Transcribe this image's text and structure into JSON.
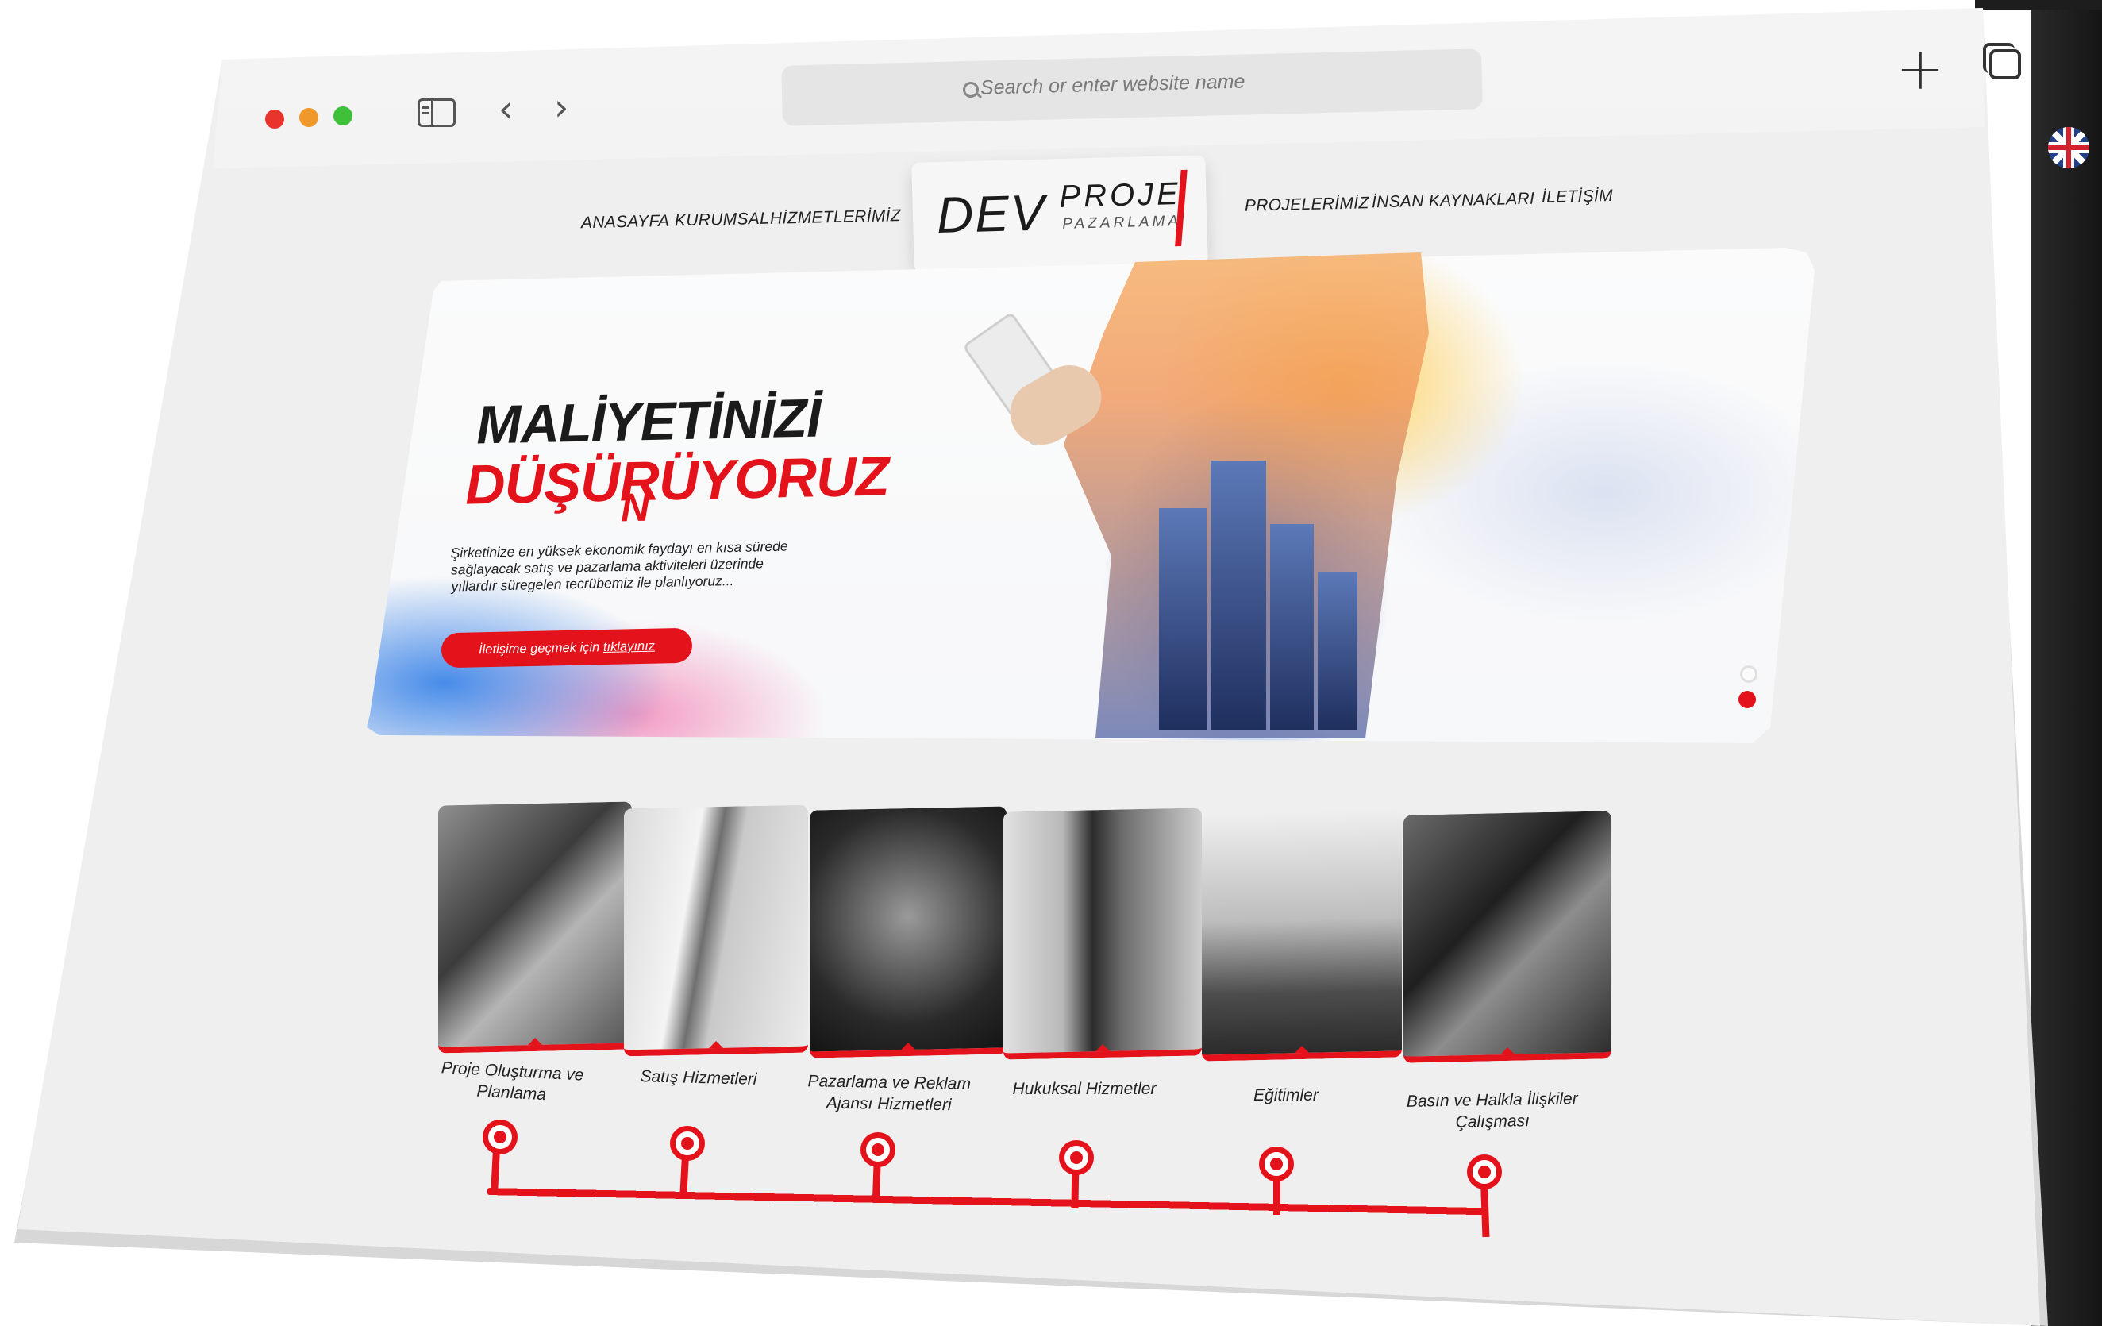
{
  "browser": {
    "address_placeholder": "Search or enter website name",
    "icons": [
      "sidebar-icon",
      "back-arrow-icon",
      "forward-arrow-icon",
      "search-icon",
      "new-tab-plus-icon",
      "tabs-overview-icon",
      "uk-flag-icon"
    ]
  },
  "site": {
    "nav_left": [
      "ANASAYFA",
      "KURUMSAL",
      "HİZMETLERİMİZ"
    ],
    "nav_right": [
      "PROJELERİMİZ",
      "İNSAN KAYNAKLARI",
      "İLETİŞİM"
    ],
    "logo": {
      "dev": "DEV",
      "proje": "PROJE",
      "pazarlama": "PAZARLAMA"
    },
    "accent_color": "#e3121b"
  },
  "hero": {
    "line1": "MALİYETİNİZİ",
    "line2": "DÜŞÜRÜYORUZ",
    "line2_overlay": "N",
    "description": "Şirketinize en yüksek ekonomik faydayı en kısa sürede sağlayacak satış ve pazarlama aktiviteleri üzerinde yıllardır süregelen tecrübemiz ile planlıyoruz...",
    "button_prefix": "İletişime geçmek için ",
    "button_link": "tıklayınız",
    "slides_total": 2,
    "slide_active": 2
  },
  "services": [
    {
      "label": "Proje Oluşturma ve Planlama"
    },
    {
      "label": "Satış Hizmetleri"
    },
    {
      "label": "Pazarlama ve Reklam Ajansı Hizmetleri"
    },
    {
      "label": "Hukuksal Hizmetler"
    },
    {
      "label": "Eğitimler"
    },
    {
      "label": "Basın ve Halkla İlişkiler Çalışması"
    }
  ]
}
